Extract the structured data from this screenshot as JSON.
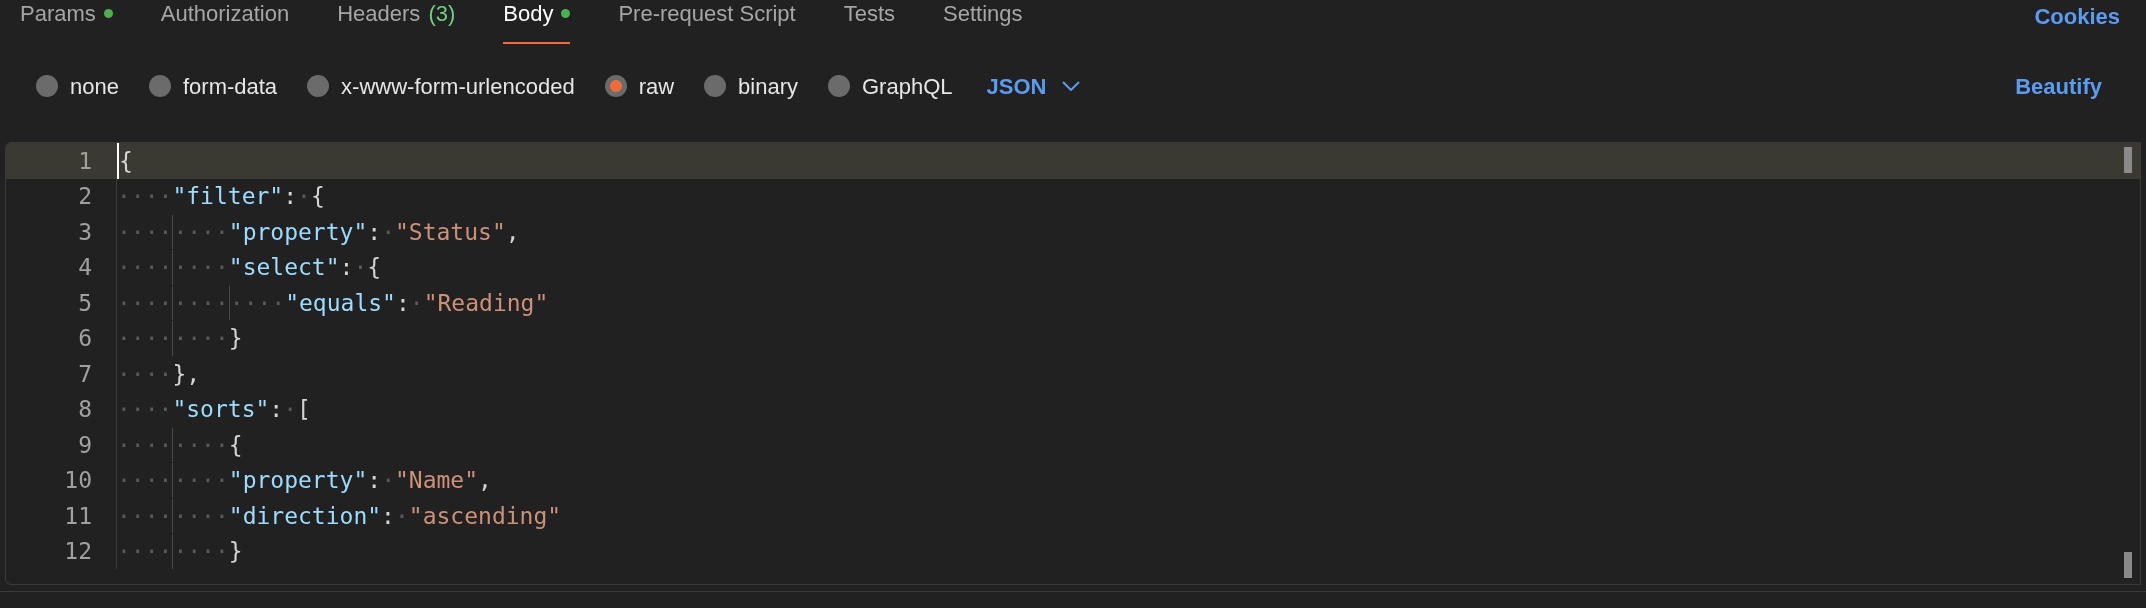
{
  "tabs": [
    {
      "label": "Params",
      "selected": false,
      "has_content": true
    },
    {
      "label": "Authorization",
      "selected": false,
      "has_content": false
    },
    {
      "label": "Headers",
      "count": "(3)",
      "selected": false,
      "has_content": false
    },
    {
      "label": "Body",
      "selected": true,
      "has_content": true
    },
    {
      "label": "Pre-request Script",
      "selected": false,
      "has_content": false
    },
    {
      "label": "Tests",
      "selected": false,
      "has_content": false
    },
    {
      "label": "Settings",
      "selected": false,
      "has_content": false
    }
  ],
  "cookies_link": "Cookies",
  "body_types": [
    {
      "label": "none",
      "selected": false
    },
    {
      "label": "form-data",
      "selected": false
    },
    {
      "label": "x-www-form-urlencoded",
      "selected": false
    },
    {
      "label": "raw",
      "selected": true
    },
    {
      "label": "binary",
      "selected": false
    },
    {
      "label": "GraphQL",
      "selected": false
    }
  ],
  "format_dropdown": "JSON",
  "beautify_link": "Beautify",
  "editor": {
    "lines": [
      {
        "number": "1",
        "current": true,
        "tokens": [
          {
            "kind": "punct",
            "text": "{"
          }
        ]
      },
      {
        "number": "2",
        "current": false,
        "tokens": [
          {
            "kind": "indent",
            "text": "····"
          },
          {
            "kind": "key",
            "text": "\"filter\""
          },
          {
            "kind": "punct",
            "text": ":"
          },
          {
            "kind": "space",
            "text": "·"
          },
          {
            "kind": "punct",
            "text": "{"
          }
        ]
      },
      {
        "number": "3",
        "current": false,
        "tokens": [
          {
            "kind": "indent",
            "text": "····"
          },
          {
            "kind": "indent",
            "text": "····"
          },
          {
            "kind": "key",
            "text": "\"property\""
          },
          {
            "kind": "punct",
            "text": ":"
          },
          {
            "kind": "space",
            "text": "·"
          },
          {
            "kind": "string",
            "text": "\"Status\""
          },
          {
            "kind": "punct",
            "text": ","
          }
        ]
      },
      {
        "number": "4",
        "current": false,
        "tokens": [
          {
            "kind": "indent",
            "text": "····"
          },
          {
            "kind": "indent",
            "text": "····"
          },
          {
            "kind": "key",
            "text": "\"select\""
          },
          {
            "kind": "punct",
            "text": ":"
          },
          {
            "kind": "space",
            "text": "·"
          },
          {
            "kind": "punct",
            "text": "{"
          }
        ]
      },
      {
        "number": "5",
        "current": false,
        "tokens": [
          {
            "kind": "indent",
            "text": "····"
          },
          {
            "kind": "indent",
            "text": "····"
          },
          {
            "kind": "indent",
            "text": "····"
          },
          {
            "kind": "key",
            "text": "\"equals\""
          },
          {
            "kind": "punct",
            "text": ":"
          },
          {
            "kind": "space",
            "text": "·"
          },
          {
            "kind": "string",
            "text": "\"Reading\""
          }
        ]
      },
      {
        "number": "6",
        "current": false,
        "tokens": [
          {
            "kind": "indent",
            "text": "····"
          },
          {
            "kind": "indent",
            "text": "····"
          },
          {
            "kind": "punct",
            "text": "}"
          }
        ]
      },
      {
        "number": "7",
        "current": false,
        "tokens": [
          {
            "kind": "indent",
            "text": "····"
          },
          {
            "kind": "punct",
            "text": "},"
          }
        ]
      },
      {
        "number": "8",
        "current": false,
        "tokens": [
          {
            "kind": "indent",
            "text": "····"
          },
          {
            "kind": "key",
            "text": "\"sorts\""
          },
          {
            "kind": "punct",
            "text": ":"
          },
          {
            "kind": "space",
            "text": "·"
          },
          {
            "kind": "punct",
            "text": "["
          }
        ]
      },
      {
        "number": "9",
        "current": false,
        "tokens": [
          {
            "kind": "indent",
            "text": "····"
          },
          {
            "kind": "indent",
            "text": "····"
          },
          {
            "kind": "punct",
            "text": "{"
          }
        ]
      },
      {
        "number": "10",
        "current": false,
        "tokens": [
          {
            "kind": "indent",
            "text": "····"
          },
          {
            "kind": "indent",
            "text": "····"
          },
          {
            "kind": "key",
            "text": "\"property\""
          },
          {
            "kind": "punct",
            "text": ":"
          },
          {
            "kind": "space",
            "text": "·"
          },
          {
            "kind": "string",
            "text": "\"Name\""
          },
          {
            "kind": "punct",
            "text": ","
          }
        ]
      },
      {
        "number": "11",
        "current": false,
        "tokens": [
          {
            "kind": "indent",
            "text": "····"
          },
          {
            "kind": "indent",
            "text": "····"
          },
          {
            "kind": "key",
            "text": "\"direction\""
          },
          {
            "kind": "punct",
            "text": ":"
          },
          {
            "kind": "space",
            "text": "·"
          },
          {
            "kind": "string",
            "text": "\"ascending\""
          }
        ]
      },
      {
        "number": "12",
        "current": false,
        "tokens": [
          {
            "kind": "indent",
            "text": "····"
          },
          {
            "kind": "indent",
            "text": "····"
          },
          {
            "kind": "punct",
            "text": "}"
          }
        ]
      }
    ]
  }
}
